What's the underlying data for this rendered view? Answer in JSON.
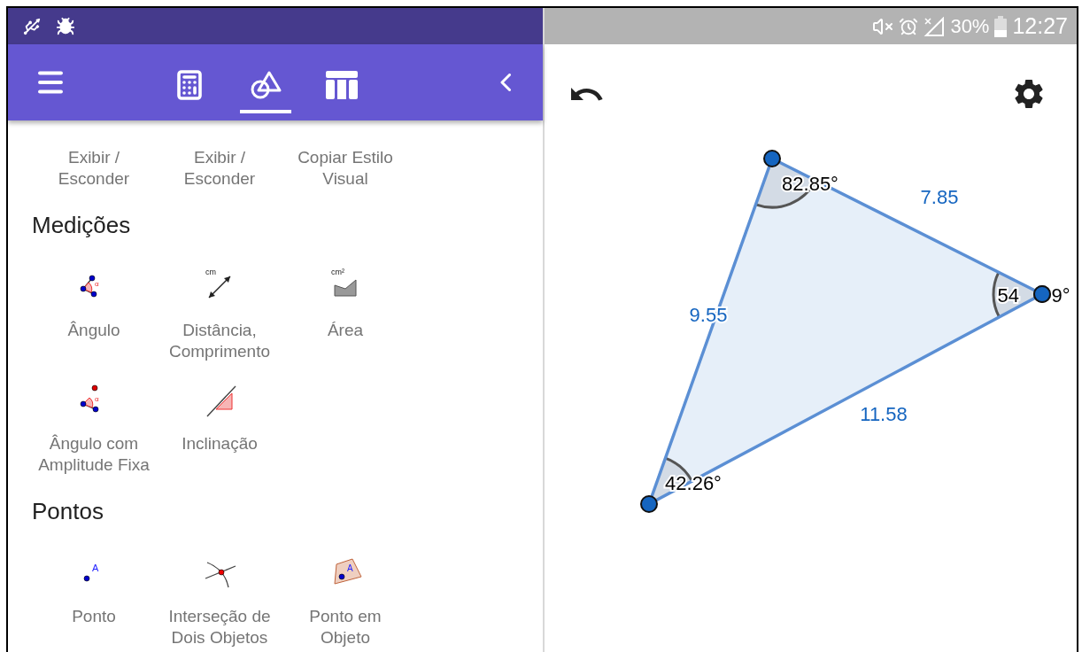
{
  "status_bar": {
    "battery": "30%",
    "time": "12:27"
  },
  "toolbar": {
    "tabs": [
      {
        "selected": false
      },
      {
        "selected": true
      },
      {
        "selected": false
      }
    ]
  },
  "tools_panel": {
    "sections": [
      {
        "tools": [
          {
            "label": "Exibir /\nEsconder"
          },
          {
            "label": "Exibir /\nEsconder"
          },
          {
            "label": "Copiar Estilo\nVisual"
          }
        ]
      },
      {
        "heading": "Medições",
        "tools": [
          {
            "label": "Ângulo",
            "icon_text": "α"
          },
          {
            "label": "Distância,\nComprimento",
            "icon_text": "cm"
          },
          {
            "label": "Área",
            "icon_text": "cm²"
          },
          {
            "label": "Ângulo com\nAmplitude Fixa",
            "icon_text": "α"
          },
          {
            "label": "Inclinação"
          }
        ]
      },
      {
        "heading": "Pontos",
        "tools": [
          {
            "label": "Ponto",
            "icon_text": "A"
          },
          {
            "label": "Interseção de\nDois Objetos"
          },
          {
            "label": "Ponto em\nObjeto",
            "icon_text": "A"
          }
        ]
      }
    ]
  },
  "graphics": {
    "sides": [
      {
        "label": "7.85"
      },
      {
        "label": "9.55"
      },
      {
        "label": "11.58"
      }
    ],
    "angles": [
      {
        "label": "82.85°"
      },
      {
        "label": "54",
        "label_after_point": "9°"
      },
      {
        "label": "42.26°"
      }
    ]
  }
}
